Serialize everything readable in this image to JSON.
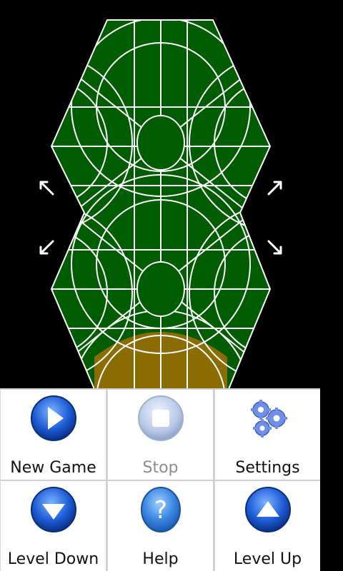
{
  "menu": {
    "items": [
      {
        "label": "New Game",
        "icon": "play-icon",
        "enabled": true
      },
      {
        "label": "Stop",
        "icon": "stop-icon",
        "enabled": false
      },
      {
        "label": "Settings",
        "icon": "gears-icon",
        "enabled": true
      },
      {
        "label": "Level Down",
        "icon": "arrow-down-icon",
        "enabled": true
      },
      {
        "label": "Help",
        "icon": "question-icon",
        "enabled": true
      },
      {
        "label": "Level Up",
        "icon": "arrow-up-icon",
        "enabled": true
      }
    ]
  },
  "board": {
    "fill_color": "#005c00",
    "line_color": "#ffffff",
    "marked_color": "#8a6c00"
  }
}
